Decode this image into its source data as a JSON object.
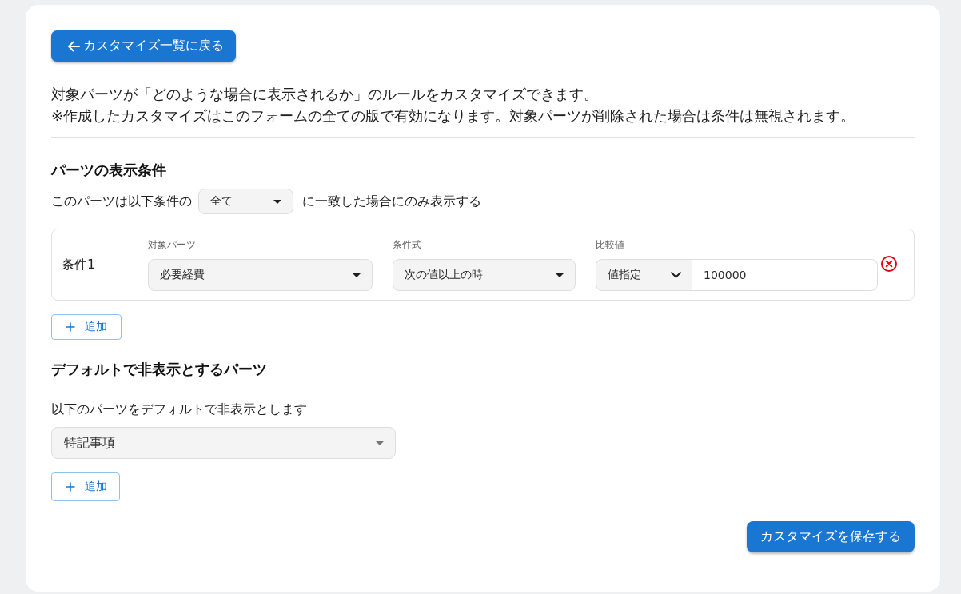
{
  "back_button": {
    "label": "カスタマイズ一覧に戻る"
  },
  "description": [
    "対象パーツが「どのような場合に表示されるか」のルールをカスタマイズできます。",
    "※作成したカスタマイズはこのフォームの全ての版で有効になります。対象パーツが削除された場合は条件は無視されます。"
  ],
  "display_conditions": {
    "heading": "パーツの表示条件",
    "match_prefix": "このパーツは以下条件の",
    "match_select": {
      "value": "全て"
    },
    "match_suffix": "に一致した場合にのみ表示する",
    "conditions": [
      {
        "label": "条件1",
        "target": {
          "label": "対象パーツ",
          "value": "必要経費"
        },
        "operator": {
          "label": "条件式",
          "value": "次の値以上の時"
        },
        "comparison": {
          "label": "比較値",
          "mode": "値指定",
          "value": "100000"
        }
      }
    ],
    "add_button": {
      "label": "追加"
    }
  },
  "hidden_parts": {
    "heading": "デフォルトで非表示とするパーツ",
    "caption": "以下のパーツをデフォルトで非表示とします",
    "parts": [
      {
        "value": "特記事項"
      }
    ],
    "add_button": {
      "label": "追加"
    }
  },
  "save_button": {
    "label": "カスタマイズを保存する"
  }
}
